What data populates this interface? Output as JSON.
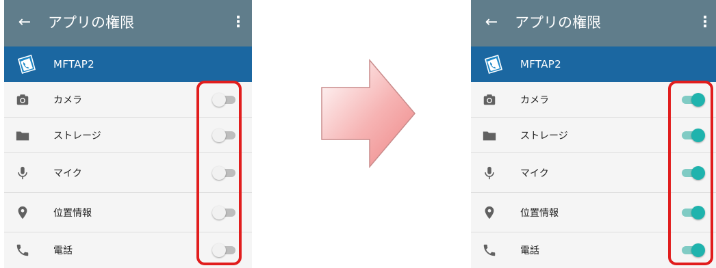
{
  "toolbar": {
    "title": "アプリの権限",
    "back_icon": "arrow-left-icon",
    "menu_icon": "more-vert-icon",
    "color": "#607d8b"
  },
  "app": {
    "name": "MFTAP2",
    "bar_color": "#1b67a1"
  },
  "permissions": [
    {
      "label": "カメラ",
      "icon": "camera-icon"
    },
    {
      "label": "ストレージ",
      "icon": "folder-icon"
    },
    {
      "label": "マイク",
      "icon": "microphone-icon"
    },
    {
      "label": "位置情報",
      "icon": "location-icon"
    },
    {
      "label": "電話",
      "icon": "phone-icon"
    }
  ],
  "before": {
    "toggle_state": "off"
  },
  "after": {
    "toggle_state": "on",
    "accent": "#1fb3ad"
  },
  "highlight_color": "#e11d1d",
  "arrow_icon": "arrow-right-icon"
}
